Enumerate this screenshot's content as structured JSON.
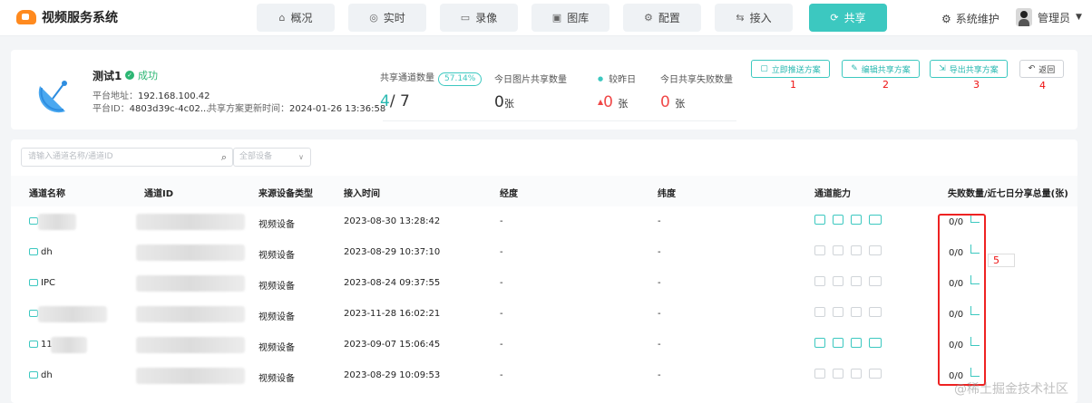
{
  "app": {
    "title": "视频服务系统"
  },
  "nav": {
    "tabs": [
      {
        "label": "概况",
        "icon": "home-icon"
      },
      {
        "label": "实时",
        "icon": "camera-icon"
      },
      {
        "label": "录像",
        "icon": "video-icon"
      },
      {
        "label": "图库",
        "icon": "image-icon"
      },
      {
        "label": "配置",
        "icon": "settings-icon"
      },
      {
        "label": "接入",
        "icon": "access-icon"
      },
      {
        "label": "共享",
        "icon": "share-icon"
      }
    ],
    "active": "共享",
    "system_maintenance": "系统维护",
    "user": "管理员"
  },
  "summary": {
    "platform_name": "测试1",
    "status": "成功",
    "address_label": "平台地址：",
    "address": "192.168.100.42",
    "id_label": "平台ID：",
    "id": "4803d39c-4c02...",
    "updated_label": "共享方案更新时间：",
    "updated_time": "2024-01-26 13:36:58",
    "shared_channels_label": "共享通道数量",
    "shared_percent": "57.14%",
    "shared_count": "4",
    "total_count": "7",
    "today_images_label": "今日图片共享数量",
    "today_images": "0",
    "unit_zhang": "张",
    "compare_label": "较昨日",
    "compare_value": "0",
    "today_fail_label": "今日共享失败数量",
    "today_fail": "0",
    "buttons": {
      "push": "立即推送方案",
      "edit": "编辑共享方案",
      "export": "导出共享方案",
      "back": "返回"
    },
    "annotations": [
      "1",
      "2",
      "3",
      "4"
    ]
  },
  "filters": {
    "search_placeholder": "请输入通道名称/通道ID",
    "device_select": "全部设备"
  },
  "table": {
    "columns": [
      "通道名称",
      "通道ID",
      "来源设备类型",
      "接入时间",
      "经度",
      "纬度",
      "通道能力",
      "失败数量/近七日分享总量(张)"
    ],
    "rows": [
      {
        "name": "",
        "source": "视频设备",
        "time": "2023-08-30 13:28:42",
        "lng": "-",
        "lat": "-",
        "fail": "0/0"
      },
      {
        "name": "dh",
        "source": "视频设备",
        "time": "2023-08-29 10:37:10",
        "lng": "-",
        "lat": "-",
        "fail": "0/0"
      },
      {
        "name": "IPC",
        "source": "视频设备",
        "time": "2023-08-24 09:37:55",
        "lng": "-",
        "lat": "-",
        "fail": "0/0"
      },
      {
        "name": "",
        "source": "视频设备",
        "time": "2023-11-28 16:02:21",
        "lng": "-",
        "lat": "-",
        "fail": "0/0"
      },
      {
        "name": "11",
        "source": "视频设备",
        "time": "2023-09-07 15:06:45",
        "lng": "-",
        "lat": "-",
        "fail": "0/0"
      },
      {
        "name": "dh",
        "source": "视频设备",
        "time": "2023-08-29 10:09:53",
        "lng": "-",
        "lat": "-",
        "fail": "0/0"
      }
    ],
    "capabilities_active": [
      true,
      false,
      false,
      false,
      true,
      false
    ]
  },
  "annotation_5": "5",
  "watermark": "@稀土掘金技术社区",
  "colors": {
    "accent": "#3cc8c0",
    "brand": "#ff8a1f",
    "alert": "#f04848"
  }
}
